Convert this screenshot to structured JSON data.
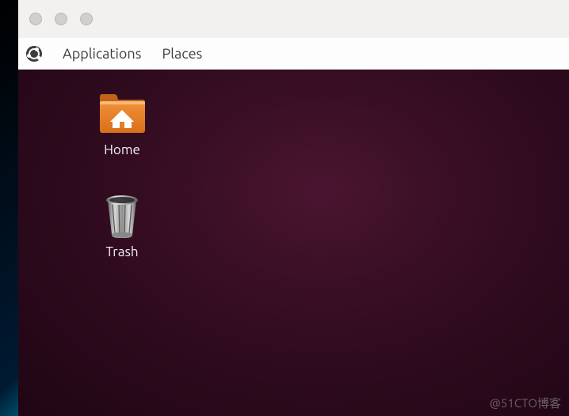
{
  "menubar": {
    "applications": "Applications",
    "places": "Places"
  },
  "desktop": {
    "icons": [
      {
        "name": "home",
        "label": "Home"
      },
      {
        "name": "trash",
        "label": "Trash"
      }
    ]
  },
  "watermark": "@51CTO博客",
  "colors": {
    "folder": "#e67e22",
    "folder_dark": "#c0621a",
    "house": "#ffffff",
    "trash_body": "#bfbfbf",
    "trash_rim": "#7a7a7a",
    "desktop_bg": "#2d0a1d"
  }
}
